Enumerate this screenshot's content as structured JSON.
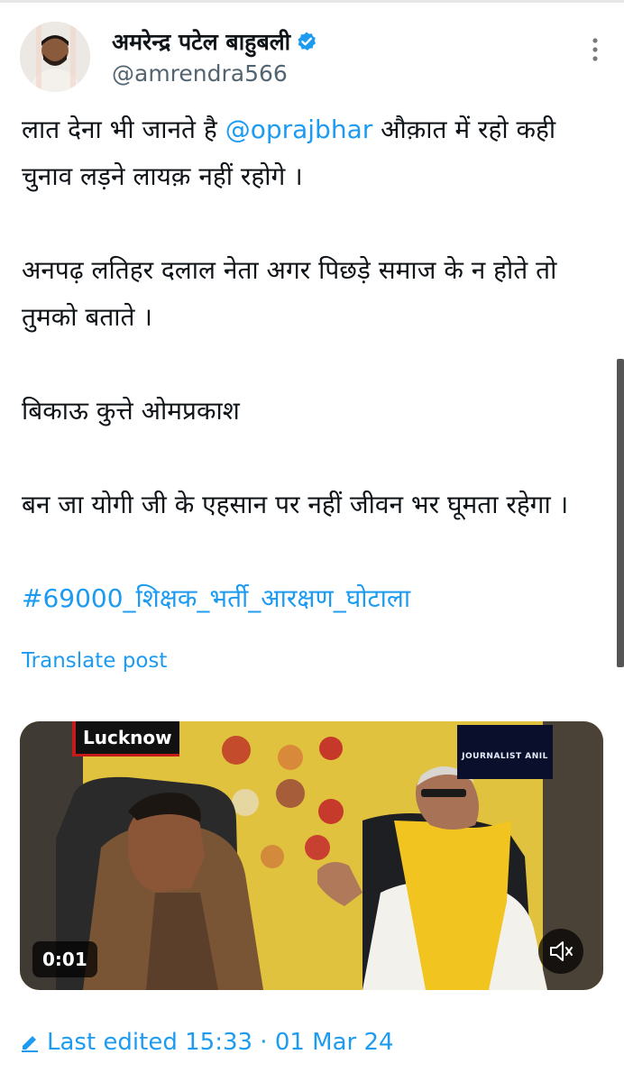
{
  "author": {
    "display_name": "अमरेन्द्र पटेल बाहुबली",
    "handle": "@amrendra566"
  },
  "tweet": {
    "line1_before": "लात देना भी जानते है ",
    "mention": "@oprajbhar",
    "line1_after": "  औक़ात में रहो कही चुनाव लड़ने लायक़ नहीं रहोगे ।",
    "para2": "अनपढ़ लतिहर दलाल नेता अगर पिछड़े समाज के न होते तो तुमको बताते ।",
    "para3": "बिकाऊ कुत्ते ओमप्रकाश",
    "para4": "बन जा योगी जी के एहसान पर नहीं जीवन भर घूमता रहेगा ।",
    "hashtag": "#69000_शिक्षक_भर्ती_आरक्षण_घोटाला",
    "translate_label": "Translate post"
  },
  "media": {
    "location_tag": "Lucknow",
    "channel_logo_text": "JOURNALIST ANIL",
    "duration": "0:01"
  },
  "edited": {
    "text": "Last edited 15:33 · 01 Mar 24"
  },
  "colors": {
    "link": "#1d9bf0",
    "text": "#0f1419",
    "secondary": "#536471"
  }
}
